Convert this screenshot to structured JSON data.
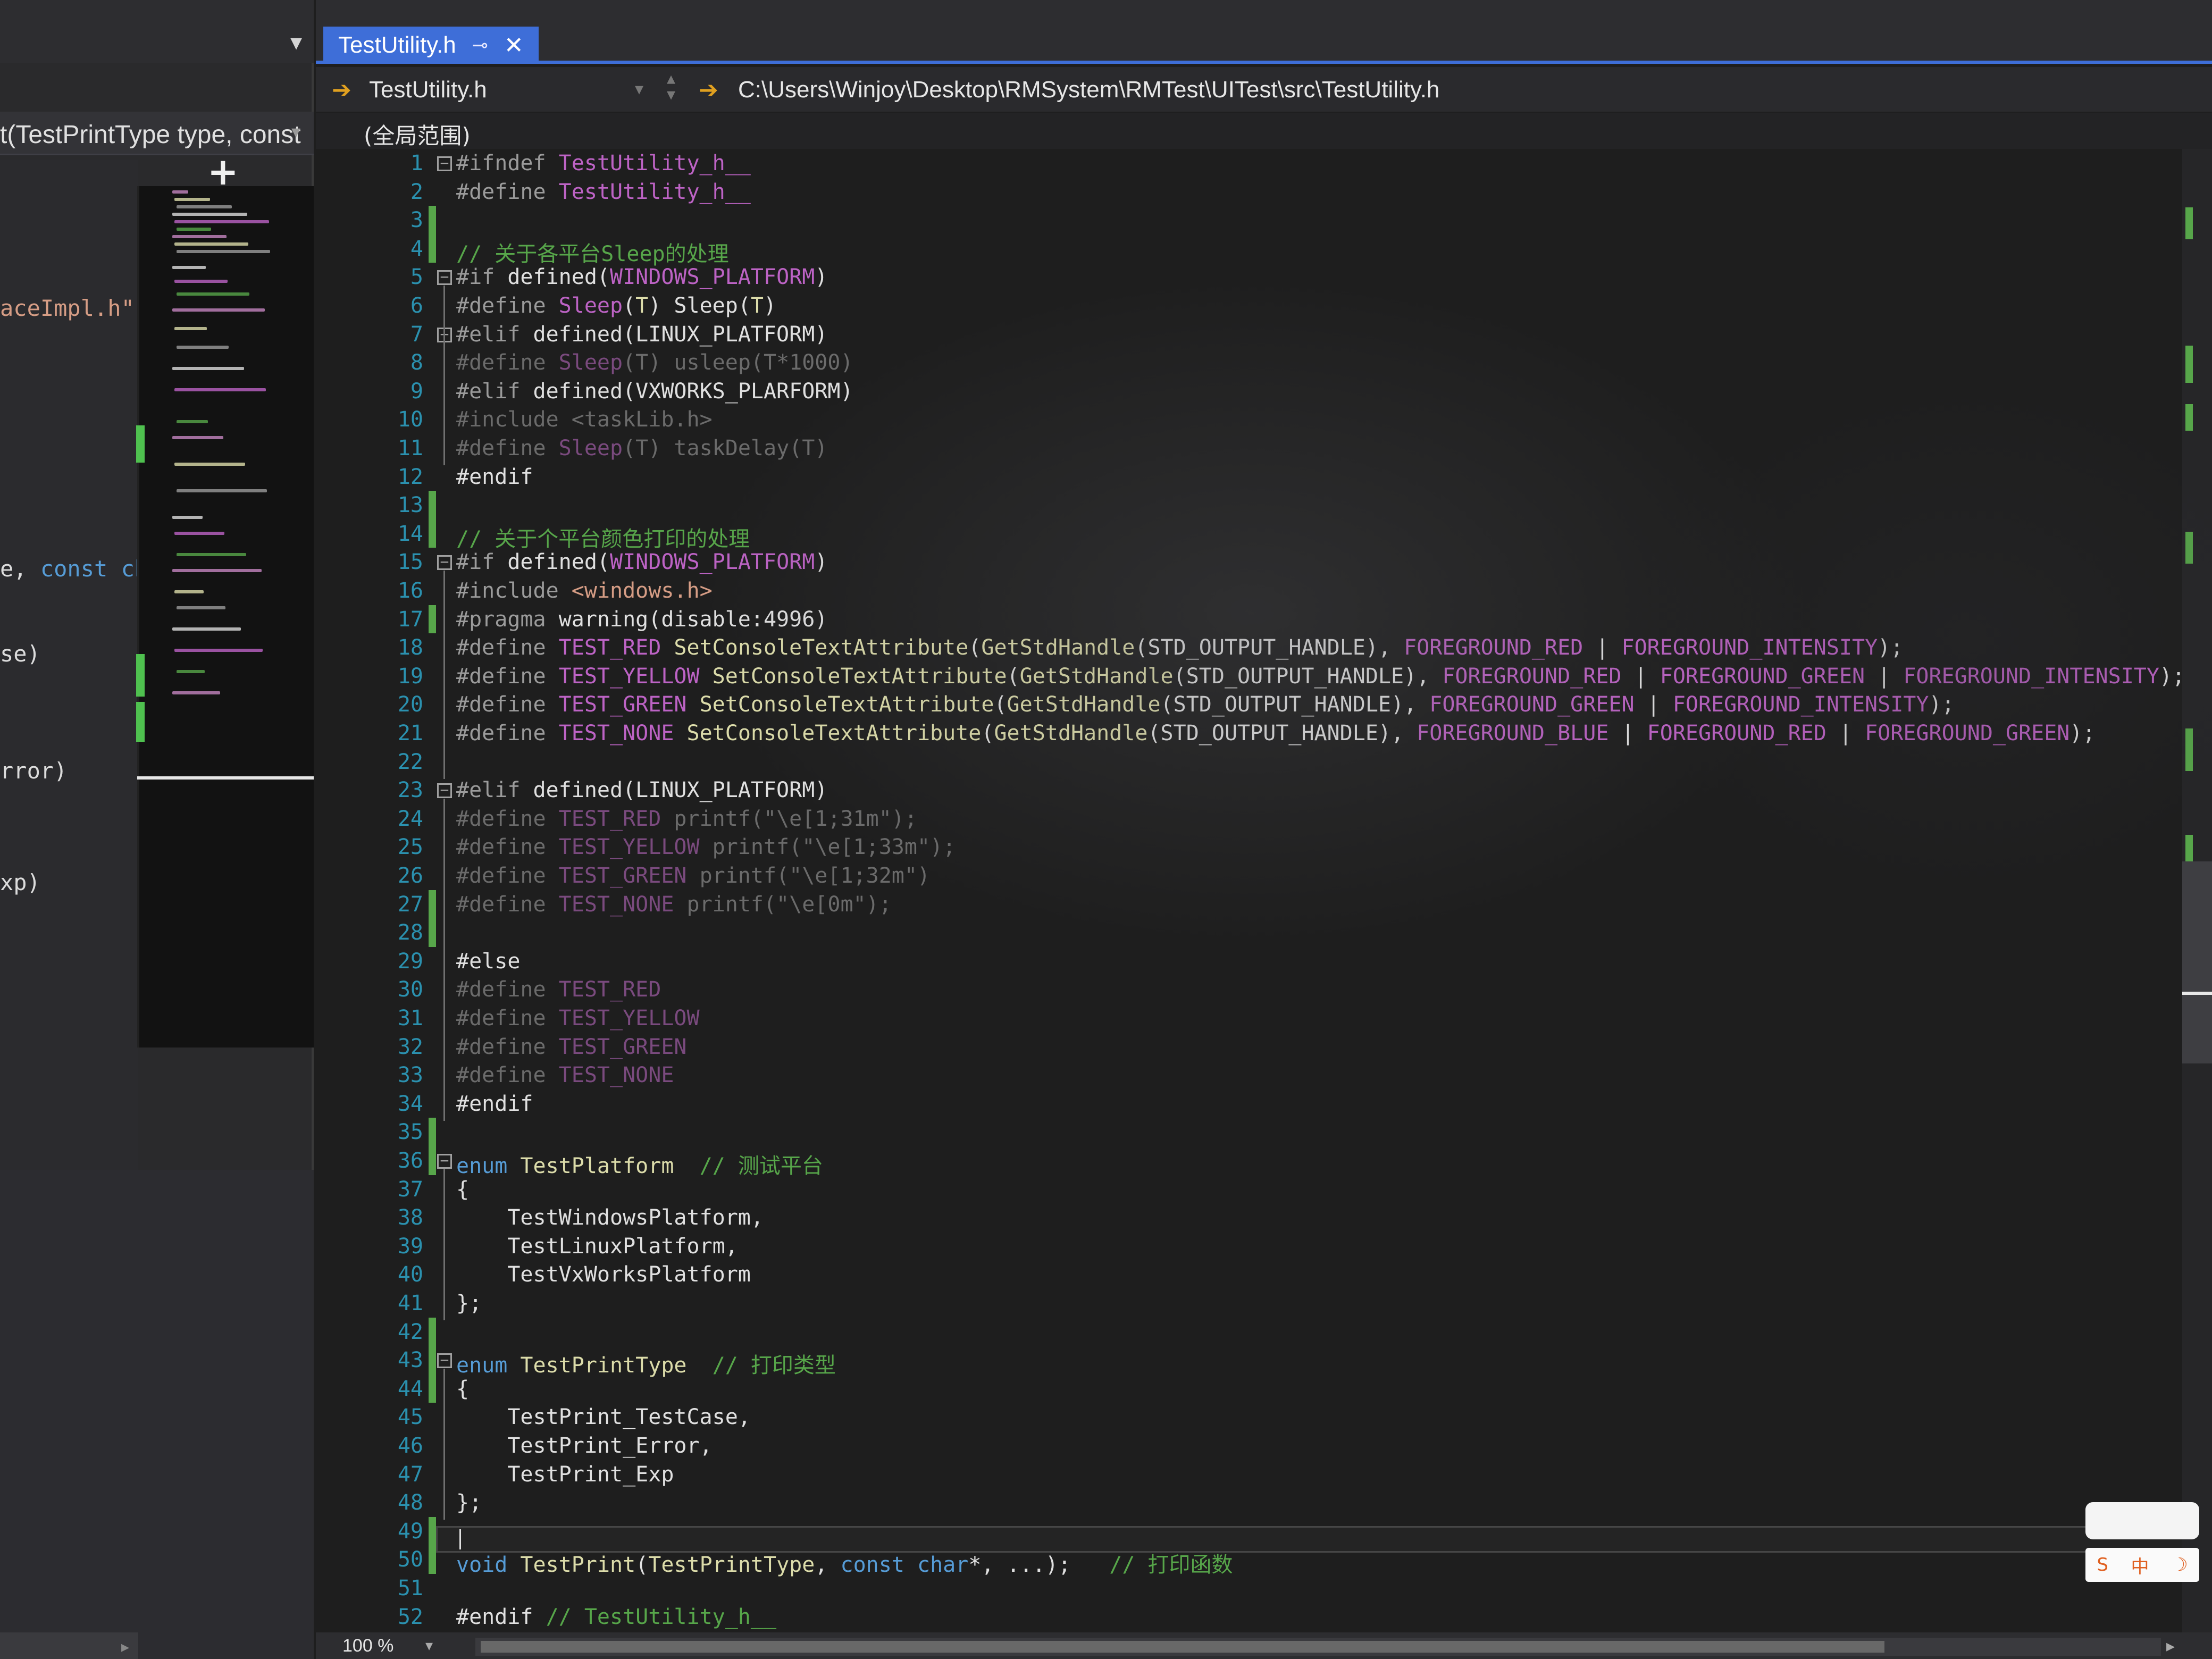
{
  "left_panel": {
    "func_signature": "t(TestPrintType type, const",
    "code_lines": [
      {
        "parts": [
          {
            "t": "aceImpl.h\"",
            "c": "str"
          }
        ]
      },
      {
        "parts": [
          {
            "t": "e, ",
            "c": "plain"
          },
          {
            "t": "const",
            "c": "kw"
          },
          {
            "t": " cha",
            "c": "kw"
          }
        ]
      },
      {
        "parts": [
          {
            "t": "se)",
            "c": "plain"
          }
        ]
      },
      {
        "parts": [
          {
            "t": "rror)",
            "c": "plain"
          }
        ]
      },
      {
        "parts": [
          {
            "t": "xp)",
            "c": "plain"
          }
        ]
      }
    ]
  },
  "tab": {
    "title": "TestUtility.h",
    "pin_icon": "⊸",
    "close_icon": "✕"
  },
  "navbar": {
    "file_dropdown": "TestUtility.h",
    "path": "C:\\Users\\Winjoy\\Desktop\\RMSystem\\RMTest\\UITest\\src\\TestUtility.h"
  },
  "scope": {
    "label": "(全局范围)"
  },
  "editor": {
    "lines": [
      {
        "n": "1",
        "fold": "⊟",
        "bar": false,
        "parts": [
          {
            "t": "#ifndef ",
            "c": "pp"
          },
          {
            "t": "TestUtility_h__",
            "c": "macro"
          }
        ]
      },
      {
        "n": "2",
        "bar": false,
        "parts": [
          {
            "t": "#define ",
            "c": "pp"
          },
          {
            "t": "TestUtility_h__",
            "c": "macro"
          }
        ]
      },
      {
        "n": "3",
        "bar": true,
        "parts": []
      },
      {
        "n": "4",
        "bar": true,
        "parts": [
          {
            "t": "// 关于各平台Sleep的处理",
            "c": "comment"
          }
        ]
      },
      {
        "n": "5",
        "fold": "⊟",
        "bar": false,
        "parts": [
          {
            "t": "#if ",
            "c": "pp"
          },
          {
            "t": "defined",
            "c": "plain"
          },
          {
            "t": "(",
            "c": "plain"
          },
          {
            "t": "WINDOWS_PLATFORM",
            "c": "macro"
          },
          {
            "t": ")",
            "c": "plain"
          }
        ]
      },
      {
        "n": "6",
        "bar": false,
        "parts": [
          {
            "t": "#define ",
            "c": "pp"
          },
          {
            "t": "Sleep",
            "c": "macro"
          },
          {
            "t": "(",
            "c": "plain"
          },
          {
            "t": "T",
            "c": "fn"
          },
          {
            "t": ") Sleep(",
            "c": "plain"
          },
          {
            "t": "T",
            "c": "fn"
          },
          {
            "t": ")",
            "c": "plain"
          }
        ]
      },
      {
        "n": "7",
        "fold": "⊟",
        "bar": false,
        "parts": [
          {
            "t": "#elif ",
            "c": "pp"
          },
          {
            "t": "defined(LINUX_PLATFORM)",
            "c": "plain"
          }
        ]
      },
      {
        "n": "8",
        "bar": false,
        "parts": [
          {
            "t": "#define ",
            "c": "inactive"
          },
          {
            "t": "Sleep",
            "c": "inactive-macro"
          },
          {
            "t": "(T) usleep(T*1000)",
            "c": "inactive"
          }
        ]
      },
      {
        "n": "9",
        "bar": false,
        "parts": [
          {
            "t": "#elif ",
            "c": "pp"
          },
          {
            "t": "defined(VXWORKS_PLARFORM)",
            "c": "plain"
          }
        ]
      },
      {
        "n": "10",
        "bar": false,
        "parts": [
          {
            "t": "#include <taskLib.h>",
            "c": "inactive"
          }
        ]
      },
      {
        "n": "11",
        "bar": false,
        "parts": [
          {
            "t": "#define ",
            "c": "inactive"
          },
          {
            "t": "Sleep",
            "c": "inactive-macro"
          },
          {
            "t": "(T) taskDelay(T)",
            "c": "inactive"
          }
        ]
      },
      {
        "n": "12",
        "bar": false,
        "parts": [
          {
            "t": "#endif",
            "c": "plain"
          }
        ]
      },
      {
        "n": "13",
        "bar": true,
        "parts": []
      },
      {
        "n": "14",
        "bar": true,
        "parts": [
          {
            "t": "// 关于个平台颜色打印的处理",
            "c": "comment"
          }
        ]
      },
      {
        "n": "15",
        "fold": "⊟",
        "bar": false,
        "parts": [
          {
            "t": "#if ",
            "c": "pp"
          },
          {
            "t": "defined",
            "c": "plain"
          },
          {
            "t": "(",
            "c": "plain"
          },
          {
            "t": "WINDOWS_PLATFORM",
            "c": "macro"
          },
          {
            "t": ")",
            "c": "plain"
          }
        ]
      },
      {
        "n": "16",
        "bar": false,
        "parts": [
          {
            "t": "#include ",
            "c": "pp"
          },
          {
            "t": "<windows.h>",
            "c": "str"
          }
        ]
      },
      {
        "n": "17",
        "bar": true,
        "parts": [
          {
            "t": "#pragma ",
            "c": "pp"
          },
          {
            "t": "warning(disable:4996)",
            "c": "plain"
          }
        ]
      },
      {
        "n": "18",
        "bar": false,
        "parts": [
          {
            "t": "#define ",
            "c": "pp"
          },
          {
            "t": "TEST_RED ",
            "c": "macro"
          },
          {
            "t": "SetConsoleTextAttribute",
            "c": "fn"
          },
          {
            "t": "(",
            "c": "plain"
          },
          {
            "t": "GetStdHandle",
            "c": "fn"
          },
          {
            "t": "(STD_OUTPUT_HANDLE), ",
            "c": "plain"
          },
          {
            "t": "FOREGROUND_RED",
            "c": "macro"
          },
          {
            "t": " | ",
            "c": "plain"
          },
          {
            "t": "FOREGROUND_INTENSITY",
            "c": "macro"
          },
          {
            "t": ");",
            "c": "plain"
          }
        ]
      },
      {
        "n": "19",
        "bar": false,
        "parts": [
          {
            "t": "#define ",
            "c": "pp"
          },
          {
            "t": "TEST_YELLOW ",
            "c": "macro"
          },
          {
            "t": "SetConsoleTextAttribute",
            "c": "fn"
          },
          {
            "t": "(",
            "c": "plain"
          },
          {
            "t": "GetStdHandle",
            "c": "fn"
          },
          {
            "t": "(STD_OUTPUT_HANDLE), ",
            "c": "plain"
          },
          {
            "t": "FOREGROUND_RED",
            "c": "macro"
          },
          {
            "t": " | ",
            "c": "plain"
          },
          {
            "t": "FOREGROUND_GREEN",
            "c": "macro"
          },
          {
            "t": " | ",
            "c": "plain"
          },
          {
            "t": "FOREGROUND_INTENSITY",
            "c": "macro"
          },
          {
            "t": ");",
            "c": "plain"
          }
        ]
      },
      {
        "n": "20",
        "bar": false,
        "parts": [
          {
            "t": "#define ",
            "c": "pp"
          },
          {
            "t": "TEST_GREEN ",
            "c": "macro"
          },
          {
            "t": "SetConsoleTextAttribute",
            "c": "fn"
          },
          {
            "t": "(",
            "c": "plain"
          },
          {
            "t": "GetStdHandle",
            "c": "fn"
          },
          {
            "t": "(STD_OUTPUT_HANDLE), ",
            "c": "plain"
          },
          {
            "t": "FOREGROUND_GREEN",
            "c": "macro"
          },
          {
            "t": " | ",
            "c": "plain"
          },
          {
            "t": "FOREGROUND_INTENSITY",
            "c": "macro"
          },
          {
            "t": ");",
            "c": "plain"
          }
        ]
      },
      {
        "n": "21",
        "bar": false,
        "parts": [
          {
            "t": "#define ",
            "c": "pp"
          },
          {
            "t": "TEST_NONE ",
            "c": "macro"
          },
          {
            "t": "SetConsoleTextAttribute",
            "c": "fn"
          },
          {
            "t": "(",
            "c": "plain"
          },
          {
            "t": "GetStdHandle",
            "c": "fn"
          },
          {
            "t": "(STD_OUTPUT_HANDLE), ",
            "c": "plain"
          },
          {
            "t": "FOREGROUND_BLUE",
            "c": "macro"
          },
          {
            "t": " | ",
            "c": "plain"
          },
          {
            "t": "FOREGROUND_RED",
            "c": "macro"
          },
          {
            "t": " | ",
            "c": "plain"
          },
          {
            "t": "FOREGROUND_GREEN",
            "c": "macro"
          },
          {
            "t": ");",
            "c": "plain"
          }
        ]
      },
      {
        "n": "22",
        "bar": false,
        "parts": []
      },
      {
        "n": "23",
        "fold": "⊟",
        "bar": false,
        "parts": [
          {
            "t": "#elif ",
            "c": "pp"
          },
          {
            "t": "defined(LINUX_PLATFORM)",
            "c": "plain"
          }
        ]
      },
      {
        "n": "24",
        "bar": false,
        "parts": [
          {
            "t": "#define ",
            "c": "inactive"
          },
          {
            "t": "TEST_RED ",
            "c": "inactive-macro"
          },
          {
            "t": "printf(\"\\e[1;31m\");",
            "c": "inactive"
          }
        ]
      },
      {
        "n": "25",
        "bar": false,
        "parts": [
          {
            "t": "#define ",
            "c": "inactive"
          },
          {
            "t": "TEST_YELLOW ",
            "c": "inactive-macro"
          },
          {
            "t": "printf(\"\\e[1;33m\");",
            "c": "inactive"
          }
        ]
      },
      {
        "n": "26",
        "bar": false,
        "parts": [
          {
            "t": "#define ",
            "c": "inactive"
          },
          {
            "t": "TEST_GREEN ",
            "c": "inactive-macro"
          },
          {
            "t": "printf(\"\\e[1;32m\")",
            "c": "inactive"
          }
        ]
      },
      {
        "n": "27",
        "bar": true,
        "parts": [
          {
            "t": "#define ",
            "c": "inactive"
          },
          {
            "t": "TEST_NONE ",
            "c": "inactive-macro"
          },
          {
            "t": "printf(\"\\e[0m\");",
            "c": "inactive"
          }
        ]
      },
      {
        "n": "28",
        "bar": true,
        "parts": []
      },
      {
        "n": "29",
        "bar": false,
        "parts": [
          {
            "t": "#else",
            "c": "plain"
          }
        ]
      },
      {
        "n": "30",
        "bar": false,
        "parts": [
          {
            "t": "#define ",
            "c": "inactive"
          },
          {
            "t": "TEST_RED",
            "c": "inactive-macro"
          }
        ]
      },
      {
        "n": "31",
        "bar": false,
        "parts": [
          {
            "t": "#define ",
            "c": "inactive"
          },
          {
            "t": "TEST_YELLOW",
            "c": "inactive-macro"
          }
        ]
      },
      {
        "n": "32",
        "bar": false,
        "parts": [
          {
            "t": "#define ",
            "c": "inactive"
          },
          {
            "t": "TEST_GREEN",
            "c": "inactive-macro"
          }
        ]
      },
      {
        "n": "33",
        "bar": false,
        "parts": [
          {
            "t": "#define ",
            "c": "inactive"
          },
          {
            "t": "TEST_NONE",
            "c": "inactive-macro"
          }
        ]
      },
      {
        "n": "34",
        "bar": false,
        "parts": [
          {
            "t": "#endif",
            "c": "plain"
          }
        ]
      },
      {
        "n": "35",
        "bar": true,
        "parts": []
      },
      {
        "n": "36",
        "fold": "⊟",
        "bar": true,
        "parts": [
          {
            "t": "enum ",
            "c": "kw"
          },
          {
            "t": "TestPlatform",
            "c": "fn"
          },
          {
            "t": "  ",
            "c": "plain"
          },
          {
            "t": "// 测试平台",
            "c": "comment"
          }
        ]
      },
      {
        "n": "37",
        "bar": false,
        "parts": [
          {
            "t": "{",
            "c": "plain"
          }
        ]
      },
      {
        "n": "38",
        "bar": false,
        "parts": [
          {
            "t": "    TestWindowsPlatform,",
            "c": "plain"
          }
        ]
      },
      {
        "n": "39",
        "bar": false,
        "parts": [
          {
            "t": "    TestLinuxPlatform,",
            "c": "plain"
          }
        ]
      },
      {
        "n": "40",
        "bar": false,
        "parts": [
          {
            "t": "    TestVxWorksPlatform",
            "c": "plain"
          }
        ]
      },
      {
        "n": "41",
        "bar": false,
        "parts": [
          {
            "t": "};",
            "c": "plain"
          }
        ]
      },
      {
        "n": "42",
        "bar": true,
        "parts": []
      },
      {
        "n": "43",
        "fold": "⊟",
        "bar": true,
        "parts": [
          {
            "t": "enum ",
            "c": "kw"
          },
          {
            "t": "TestPrintType",
            "c": "fn"
          },
          {
            "t": "  ",
            "c": "plain"
          },
          {
            "t": "// 打印类型",
            "c": "comment"
          }
        ]
      },
      {
        "n": "44",
        "bar": true,
        "parts": [
          {
            "t": "{",
            "c": "plain"
          }
        ]
      },
      {
        "n": "45",
        "bar": false,
        "parts": [
          {
            "t": "    TestPrint_TestCase,",
            "c": "plain"
          }
        ]
      },
      {
        "n": "46",
        "bar": false,
        "parts": [
          {
            "t": "    TestPrint_Error,",
            "c": "plain"
          }
        ]
      },
      {
        "n": "47",
        "bar": false,
        "parts": [
          {
            "t": "    TestPrint_Exp",
            "c": "plain"
          }
        ]
      },
      {
        "n": "48",
        "bar": false,
        "parts": [
          {
            "t": "};",
            "c": "plain"
          }
        ]
      },
      {
        "n": "49",
        "bar": true,
        "parts": []
      },
      {
        "n": "50",
        "bar": true,
        "parts": [
          {
            "t": "void ",
            "c": "kw"
          },
          {
            "t": "TestPrint",
            "c": "fn"
          },
          {
            "t": "(",
            "c": "plain"
          },
          {
            "t": "TestPrintType",
            "c": "fn"
          },
          {
            "t": ", ",
            "c": "plain"
          },
          {
            "t": "const ",
            "c": "kw"
          },
          {
            "t": "char",
            "c": "kw"
          },
          {
            "t": "*, ...);   ",
            "c": "plain"
          },
          {
            "t": "// 打印函数",
            "c": "comment"
          }
        ]
      },
      {
        "n": "51",
        "bar": false,
        "parts": []
      },
      {
        "n": "52",
        "bar": false,
        "parts": [
          {
            "t": "#endif ",
            "c": "plain"
          },
          {
            "t": "// TestUtility_h__",
            "c": "comment"
          }
        ]
      }
    ]
  },
  "status": {
    "zoom": "100 %"
  },
  "ime": {
    "mode_label": "中",
    "logo_icon": "S",
    "moon_icon": "☽"
  },
  "colors": {
    "accent": "#3e6ed8",
    "change_bar": "#57a64a",
    "line_number": "#2b91af",
    "macro": "#bd63c5",
    "function": "#dcdcaa",
    "comment": "#57a64a",
    "keyword": "#569cd6"
  }
}
